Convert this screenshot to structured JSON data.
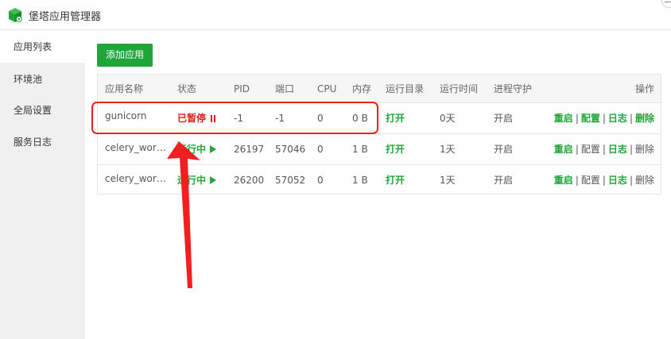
{
  "app": {
    "title": "堡塔应用管理器",
    "icon": "cube-logo-icon",
    "accent": "#20a53a"
  },
  "sidebar": {
    "items": [
      {
        "label": "应用列表",
        "active": true
      },
      {
        "label": "环境池",
        "active": false
      },
      {
        "label": "全局设置",
        "active": false
      },
      {
        "label": "服务日志",
        "active": false
      }
    ]
  },
  "toolbar": {
    "add_label": "添加应用"
  },
  "table": {
    "headers": [
      "应用名称",
      "状态",
      "PID",
      "端口",
      "CPU",
      "内存",
      "运行目录",
      "运行时间",
      "进程守护",
      "操作"
    ],
    "rows": [
      {
        "name": "gunicorn",
        "status": "已暂停",
        "status_icon": "pause-icon",
        "pid": "-1",
        "port": "-1",
        "cpu": "0",
        "mem": "0 B",
        "dir": "打开",
        "uptime": "0天",
        "guard": "开启",
        "ops": [
          "重启",
          "配置",
          "日志",
          "删除"
        ],
        "sep": "|"
      },
      {
        "name": "celery_wor…",
        "status": "运行中",
        "status_icon": "play-icon",
        "pid": "26197",
        "port": "57046",
        "cpu": "0",
        "mem": "1 B",
        "dir": "打开",
        "uptime": "1天",
        "guard": "开启",
        "ops": [
          "重启",
          "配置",
          "日志",
          "删除"
        ],
        "sep": "|"
      },
      {
        "name": "celery_wor…",
        "status": "运行中",
        "status_icon": "play-icon",
        "pid": "26200",
        "port": "57052",
        "cpu": "0",
        "mem": "1 B",
        "dir": "打开",
        "uptime": "1天",
        "guard": "开启",
        "ops": [
          "重启",
          "配置",
          "日志",
          "删除"
        ],
        "sep": "|"
      }
    ]
  },
  "annotation": {
    "color": "#f02020"
  }
}
